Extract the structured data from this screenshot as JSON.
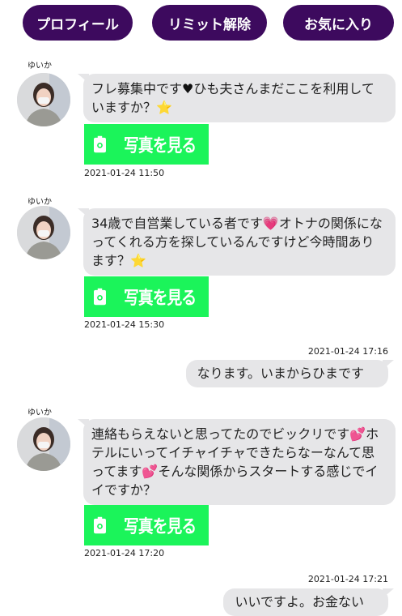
{
  "header": {
    "buttons": [
      "プロフィール",
      "リミット解除",
      "お気に入り"
    ]
  },
  "messages": [
    {
      "sender": "ゆいか",
      "text_parts": [
        "フレ募集中です",
        "♥",
        "ひも夫さんまだここを利用していますか？",
        "⭐"
      ],
      "photo_label": "写真を見る",
      "timestamp": "2021-01-24 11:50"
    },
    {
      "sender": "ゆいか",
      "text_parts": [
        "34歳で自営業している者です",
        "💗",
        "オトナの関係になってくれる方を探しているんですけど今時間あります？",
        "⭐"
      ],
      "photo_label": "写真を見る",
      "timestamp": "2021-01-24 15:30"
    },
    {
      "timestamp": "2021-01-24 17:16",
      "text": "なります。いまからひまです"
    },
    {
      "sender": "ゆいか",
      "text_parts": [
        "連絡もらえないと思ってたのでビックリです",
        "💕",
        "ホテルにいってイチャイチャできたらなーなんて思ってます",
        "💕",
        "そんな関係からスタートする感じでイイですか？"
      ],
      "photo_label": "写真を見る",
      "timestamp": "2021-01-24 17:20"
    },
    {
      "timestamp": "2021-01-24 17:21",
      "text": "いいですよ。お金ない"
    }
  ],
  "colors": {
    "header_button_bg": "#3d0a5e",
    "photo_button_bg": "#1bf45a",
    "bubble_bg": "#e6e6e8"
  },
  "icons": {
    "photo_button": "camera-icon",
    "avatar": "avatar-photo"
  }
}
